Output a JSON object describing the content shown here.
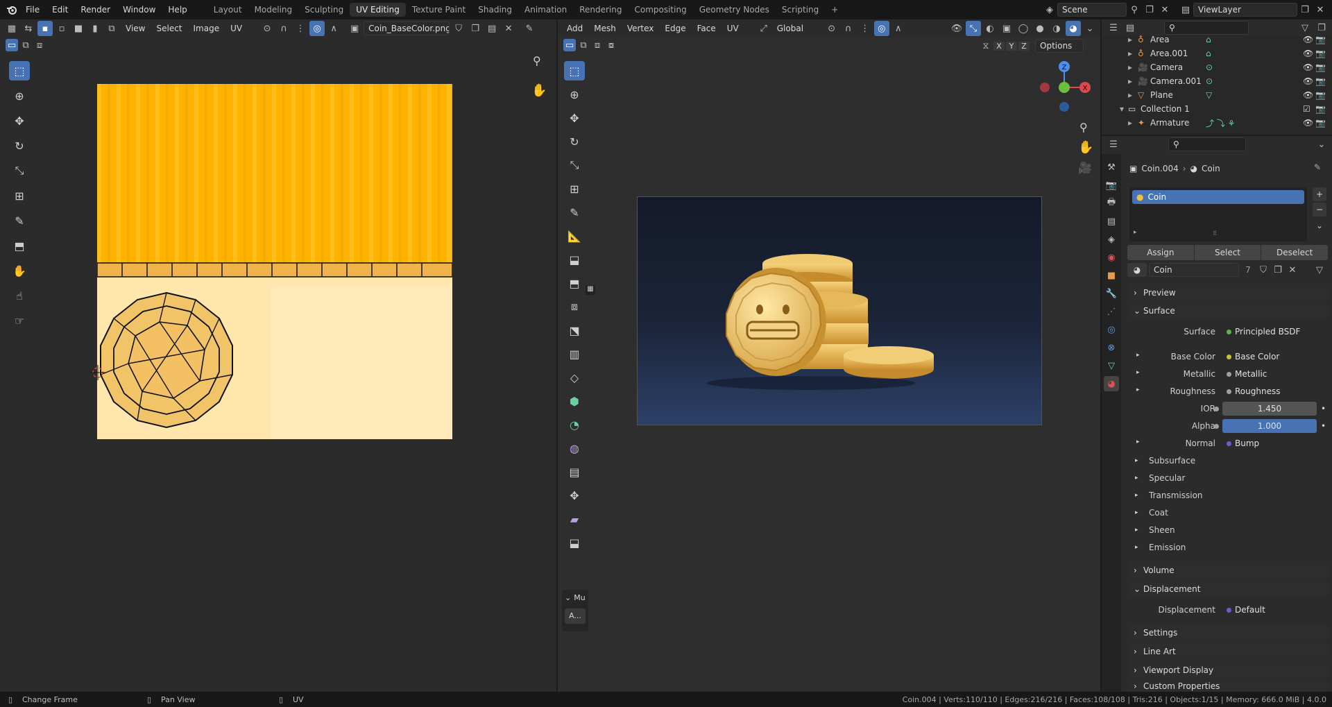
{
  "menu": [
    "File",
    "Edit",
    "Render",
    "Window",
    "Help"
  ],
  "workspaces": [
    "Layout",
    "Modeling",
    "Sculpting",
    "UV Editing",
    "Texture Paint",
    "Shading",
    "Animation",
    "Rendering",
    "Compositing",
    "Geometry Nodes",
    "Scripting"
  ],
  "active_workspace": "UV Editing",
  "scene": "Scene",
  "view_layer": "ViewLayer",
  "uv_editor": {
    "menu": [
      "View",
      "Select",
      "Image",
      "UV"
    ],
    "image_name": "Coin_BaseColor.png"
  },
  "viewport": {
    "menu": [
      "Add",
      "Mesh",
      "Vertex",
      "Edge",
      "Face",
      "UV"
    ],
    "orientation": "Global",
    "options_label": "Options",
    "axes": [
      "X",
      "Y",
      "Z"
    ],
    "gizmo": {
      "z": "Z",
      "x": "X"
    },
    "last_op_label": "Mu",
    "last_op_button": "A..."
  },
  "outliner": {
    "items": [
      {
        "name": "Area",
        "indent": 1
      },
      {
        "name": "Area.001",
        "indent": 1
      },
      {
        "name": "Camera",
        "indent": 1
      },
      {
        "name": "Camera.001",
        "indent": 1
      },
      {
        "name": "Plane",
        "indent": 1
      },
      {
        "name": "Collection 1",
        "indent": 0
      },
      {
        "name": "Armature",
        "indent": 1
      }
    ]
  },
  "properties": {
    "object": "Coin.004",
    "material_crumb": "Coin",
    "slot": "Coin",
    "buttons": [
      "Assign",
      "Select",
      "Deselect"
    ],
    "material_name": "Coin",
    "user_count": "7",
    "panels": {
      "preview": "Preview",
      "surface": "Surface",
      "volume": "Volume",
      "displacement": "Displacement",
      "settings": "Settings",
      "line_art": "Line Art",
      "viewport_display": "Viewport Display",
      "custom_properties": "Custom Properties"
    },
    "surface_rows": [
      {
        "label": "Surface",
        "value": "Principled BSDF",
        "dot": "#62b34a"
      },
      {
        "label": "Base Color",
        "value": "Base Color",
        "dot": "#c7c729"
      },
      {
        "label": "Metallic",
        "value": "Metallic",
        "dot": "#a1a1a1"
      },
      {
        "label": "Roughness",
        "value": "Roughness",
        "dot": "#a1a1a1"
      },
      {
        "label": "IOR",
        "value": "1.450",
        "dot": "#a1a1a1"
      },
      {
        "label": "Alpha",
        "value": "1.000",
        "dot": "#a1a1a1"
      },
      {
        "label": "Normal",
        "value": "Bump",
        "dot": "#6363c7"
      }
    ],
    "subpanels": [
      "Subsurface",
      "Specular",
      "Transmission",
      "Coat",
      "Sheen",
      "Emission"
    ],
    "displacement_row": {
      "label": "Displacement",
      "value": "Default",
      "dot": "#6363c7"
    }
  },
  "status": {
    "left": [
      "Change Frame",
      "Pan View",
      "UV"
    ],
    "right": "Coin.004 | Verts:110/110 | Edges:216/216 | Faces:108/108 | Tris:216 | Objects:1/15 | Memory: 666.0 MiB | 4.0.0"
  },
  "colors": {
    "accent": "#4772b3",
    "gold": "#ffb300",
    "light_gold": "#ffe6ad"
  }
}
